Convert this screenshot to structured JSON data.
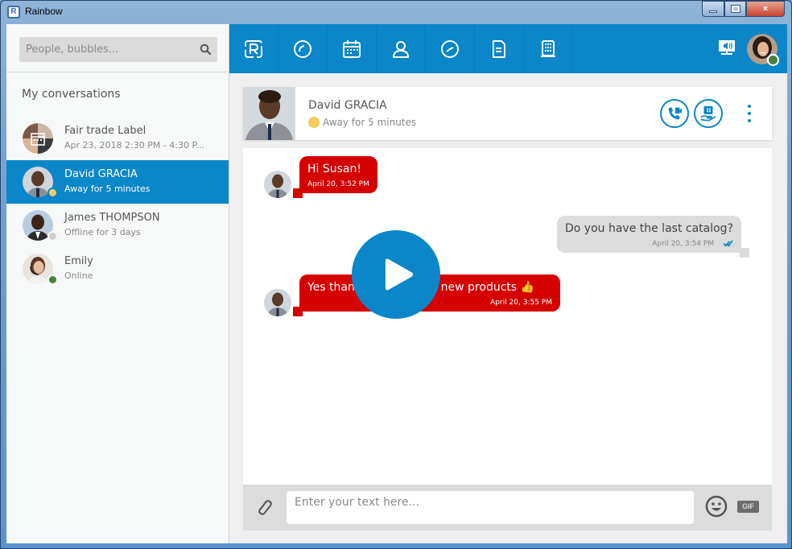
{
  "window": {
    "title": "Rainbow",
    "logo_letter": "R",
    "controls": {
      "minimize": "minimize",
      "maximize": "maximize",
      "close": "×"
    }
  },
  "sidebar": {
    "search": {
      "placeholder": "People, bubbles...",
      "value": ""
    },
    "section_title": "My conversations",
    "conversations": [
      {
        "name": "Fair trade Label",
        "subtitle": "Apr 23, 2018 2:30 PM - 4:30 P...",
        "type": "bubble-meeting",
        "status": null,
        "active": false
      },
      {
        "name": "David GRACIA",
        "subtitle": "Away for 5 minutes",
        "status": "away",
        "active": true
      },
      {
        "name": "James THOMPSON",
        "subtitle": "Offline for 3 days",
        "status": "offline",
        "active": false
      },
      {
        "name": "Emily",
        "subtitle": "Online",
        "status": "online",
        "active": false
      }
    ]
  },
  "topnav": {
    "items": [
      {
        "icon": "rainbow-logo-icon",
        "label": "Home"
      },
      {
        "icon": "recent-icon",
        "label": "Recent"
      },
      {
        "icon": "calendar-icon",
        "label": "Calendar"
      },
      {
        "icon": "contacts-icon",
        "label": "Contacts"
      },
      {
        "icon": "clock-icon",
        "label": "History"
      },
      {
        "icon": "file-icon",
        "label": "Files"
      },
      {
        "icon": "company-icon",
        "label": "Company"
      }
    ],
    "user_status": "online"
  },
  "conversation": {
    "contact_name": "David GRACIA",
    "contact_status": "Away for 5 minutes",
    "actions": [
      "call-video",
      "screen-share-request"
    ],
    "messages": [
      {
        "direction": "in",
        "text": "Hi Susan!",
        "time": "April 20, 3:52 PM"
      },
      {
        "direction": "out",
        "text": "Do you have the last catalog?",
        "time": "April 20, 3:54 PM",
        "read": true
      },
      {
        "direction": "in",
        "text_visible_start": "Yes than",
        "text_visible_end": "t of new products",
        "emoji": "👍",
        "time": "April 20, 3:55 PM"
      }
    ],
    "composer": {
      "placeholder": "Enter your text here...",
      "value": "",
      "gif_label": "GIF"
    }
  },
  "colors": {
    "brand_blue": "#0a86c9",
    "incoming_bubble": "#d50000",
    "outgoing_bubble": "#dcdcdc",
    "status_away": "#f2cf5b",
    "status_offline": "#cfcfcf",
    "status_online": "#4b7d3f"
  }
}
